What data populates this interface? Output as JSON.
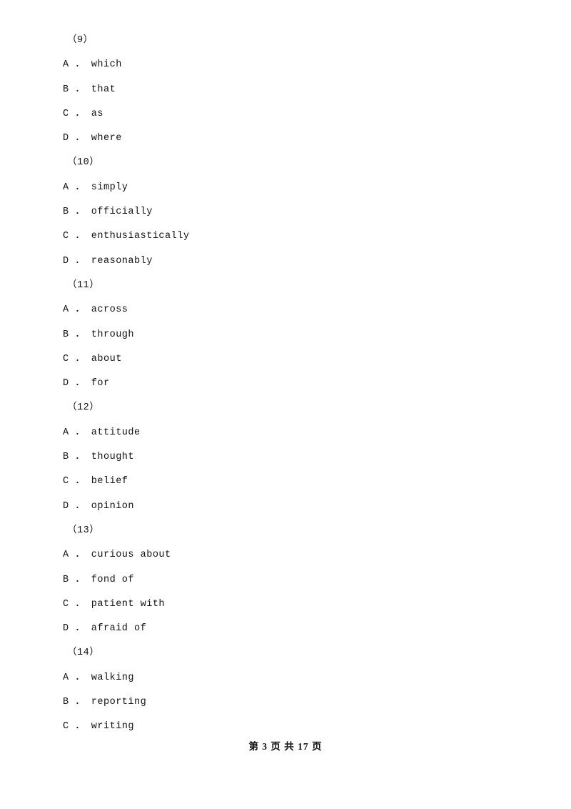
{
  "document": {
    "blocks": [
      {
        "number": "（9）",
        "options": [
          "A ． which",
          "B ． that",
          "C ． as",
          "D ． where"
        ]
      },
      {
        "number": "（10）",
        "options": [
          "A ． simply",
          "B ． officially",
          "C ． enthusiastically",
          "D ． reasonably"
        ]
      },
      {
        "number": "（11）",
        "options": [
          "A ． across",
          "B ． through",
          "C ． about",
          "D ． for"
        ]
      },
      {
        "number": "（12）",
        "options": [
          "A ． attitude",
          "B ． thought",
          "C ． belief",
          "D ． opinion"
        ]
      },
      {
        "number": "（13）",
        "options": [
          "A ． curious about",
          "B ． fond of",
          "C ． patient with",
          "D ． afraid of"
        ]
      },
      {
        "number": "（14）",
        "options": [
          "A ． walking",
          "B ． reporting",
          "C ． writing"
        ]
      }
    ],
    "footer": "第 3 页 共 17 页"
  }
}
